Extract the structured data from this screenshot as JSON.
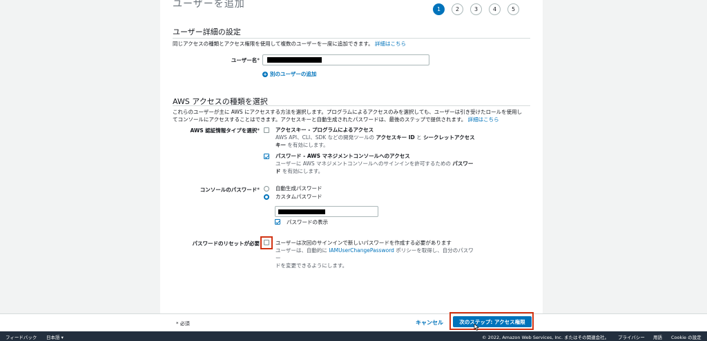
{
  "header": {
    "partial_title": "ユーザーを追加",
    "steps": [
      "1",
      "2",
      "3",
      "4",
      "5"
    ]
  },
  "details": {
    "section_title": "ユーザー詳細の設定",
    "description": "同じアクセスの種類とアクセス権限を使用して複数のユーザーを一度に追加できます。",
    "learn_more": "詳細はこちら",
    "username_label": "ユーザー名",
    "add_user_label": "別のユーザーの追加"
  },
  "access": {
    "section_title": "AWS アクセスの種類を選択",
    "description_1": "これらのユーザーが主に AWS にアクセスする方法を選択します。プログラムによるアクセスのみを選択しても、ユーザーは引き受けたロールを使用し",
    "description_2": "てコンソールにアクセスすることはできます。アクセスキーと自動生成されたパスワードは、最後のステップで提供されます。",
    "learn_more": "詳細はこちら",
    "credential_type_label": "AWS 認証情報タイプを選択",
    "option_1_title": "アクセスキー - プログラムによるアクセス",
    "option_1_desc_a": "AWS API、CLI、SDK などの開発ツールの",
    "option_1_desc_b": "アクセスキー ID",
    "option_1_desc_c": "と",
    "option_1_desc_d": "シークレットアクセス",
    "option_1_desc_e": "キー",
    "option_1_desc_f": "を有効にします。",
    "option_2_title": "パスワード - AWS マネジメントコンソールへのアクセス",
    "option_2_desc_a": "ユーザーに AWS マネジメントコンソールへのサインインを許可するための",
    "option_2_desc_b": "パスワー",
    "option_2_desc_c": "ド",
    "option_2_desc_d": "を有効にします。",
    "console_password_label": "コンソールのパスワード",
    "auto_password": "自動生成パスワード",
    "custom_password": "カスタムパスワード",
    "show_password": "パスワードの表示",
    "reset_label": "パスワードのリセットが必要",
    "reset_text": "ユーザーは次回のサインインで新しいパスワードを作成する必要があります",
    "reset_desc_a": "ユーザーは、自動的に",
    "reset_desc_link": "IAMUserChangePassword",
    "reset_desc_b": "ポリシーを取得し、自分のパスワー",
    "reset_desc_c": "ドを変更できるようにします。"
  },
  "footer": {
    "required_note": "必須",
    "cancel": "キャンセル",
    "next": "次のステップ: アクセス権限"
  },
  "console_footer": {
    "feedback": "フィードバック",
    "language": "日本語 ▾",
    "copyright": "© 2022, Amazon Web Services, Inc. またはその関連会社。",
    "privacy": "プライバシー",
    "terms": "用語",
    "cookie": "Cookie の設定"
  },
  "colors": {
    "accent": "#0073bb",
    "highlight": "#d13212",
    "footer_bg": "#232f3e"
  }
}
